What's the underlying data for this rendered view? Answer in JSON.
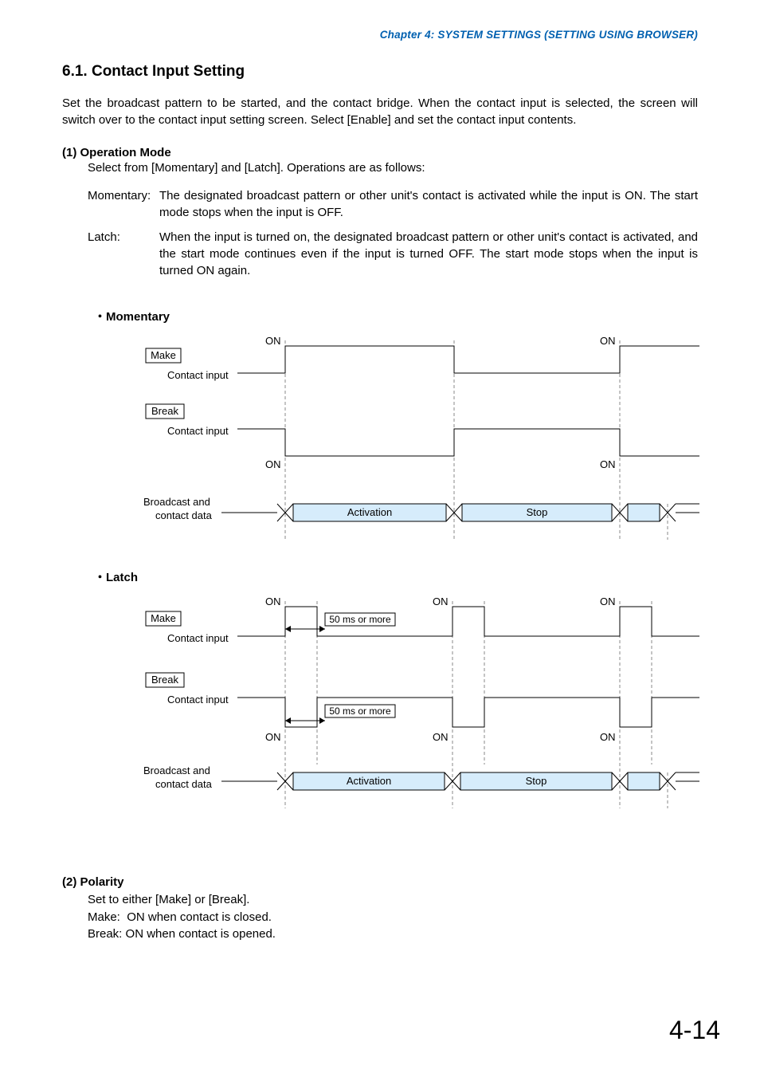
{
  "header": {
    "chapter": "Chapter 4:  SYSTEM SETTINGS (SETTING USING BROWSER)"
  },
  "section": {
    "title": "6.1. Contact Input Setting",
    "intro": "Set the broadcast pattern to be started, and the contact bridge. When the contact input is selected, the screen will switch over to the contact input setting screen. Select [Enable] and set the contact input contents."
  },
  "operation_mode": {
    "heading": "(1)  Operation Mode",
    "intro": "Select from [Momentary] and [Latch]. Operations are as follows:",
    "momentary_label": "Momentary:",
    "momentary_desc": "The designated broadcast pattern or other unit's contact is activated while the input is ON. The start mode stops when the input is OFF.",
    "latch_label": "Latch:",
    "latch_desc": "When the input is turned on, the designated broadcast pattern or other unit's contact is activated, and the start mode continues even if the input is turned OFF. The start mode stops when the input is turned ON again."
  },
  "diagram": {
    "momentary_title": "・Momentary",
    "latch_title": "・Latch",
    "labels": {
      "make": "Make",
      "break": "Break",
      "contact_input": "Contact input",
      "broadcast_line1": "Broadcast and",
      "broadcast_line2": "contact data",
      "on": "ON",
      "activation": "Activation",
      "stop": "Stop",
      "fifty_ms": "50 ms or more"
    }
  },
  "polarity": {
    "heading": "(2)  Polarity",
    "line1": "Set to either [Make] or [Break].",
    "line2a": "Make:",
    "line2b": "ON when contact is closed.",
    "line3a": "Break:",
    "line3b": "ON when contact is opened."
  },
  "page_number": "4-14"
}
